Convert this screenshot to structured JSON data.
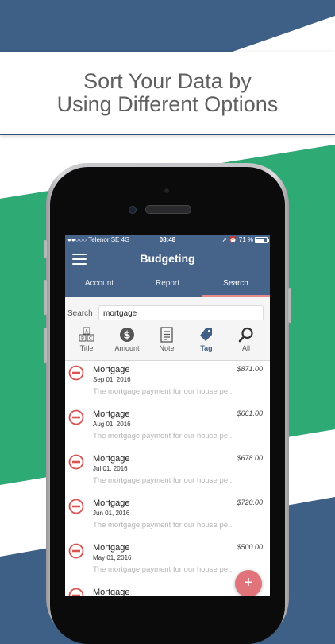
{
  "caption": {
    "line1": "Sort Your Data by",
    "line2": "Using Different Options"
  },
  "status_bar": {
    "carrier": "●●○○○ Telenor SE  4G",
    "time": "08:48",
    "right": "➚ ⏰ 71 %"
  },
  "header": {
    "title": "Budgeting"
  },
  "tabs": [
    {
      "label": "Account"
    },
    {
      "label": "Report"
    },
    {
      "label": "Search",
      "selected": true
    }
  ],
  "search": {
    "label": "Search",
    "value": "mortgage"
  },
  "filters": [
    {
      "label": "Title",
      "icon": "abc-blocks-icon"
    },
    {
      "label": "Amount",
      "icon": "dollar-circle-icon"
    },
    {
      "label": "Note",
      "icon": "note-icon"
    },
    {
      "label": "Tag",
      "icon": "tag-icon",
      "selected": true
    },
    {
      "label": "All",
      "icon": "magnifier-icon"
    }
  ],
  "results": [
    {
      "name": "Mortgage",
      "date": "Sep 01, 2016",
      "amount": "$871.00",
      "note": "The mortgage payment for our house pe..."
    },
    {
      "name": "Mortgage",
      "date": "Aug 01, 2016",
      "amount": "$661.00",
      "note": "The mortgage payment for our house pe..."
    },
    {
      "name": "Mortgage",
      "date": "Jul 01, 2016",
      "amount": "$678.00",
      "note": "The mortgage payment for our house pe..."
    },
    {
      "name": "Mortgage",
      "date": "Jun 01, 2016",
      "amount": "$720.00",
      "note": "The mortgage payment for our house pe..."
    },
    {
      "name": "Mortgage",
      "date": "May 01, 2016",
      "amount": "$500.00",
      "note": "The mortgage payment for our house pe..."
    },
    {
      "name": "Mortgage",
      "date": "",
      "amount": "",
      "note": ""
    }
  ],
  "fab": {
    "label": "+"
  },
  "colors": {
    "header": "#46648a",
    "accent_green": "#2eaa74",
    "delete_red": "#d9534f",
    "fab": "#e1747a"
  }
}
